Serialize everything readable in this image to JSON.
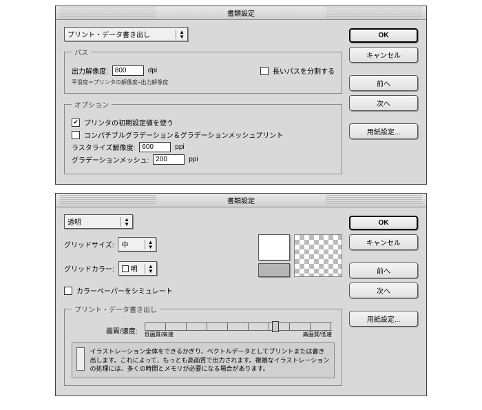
{
  "dialog1": {
    "title": "書類設定",
    "pageSelect": "プリント・データ書き出し",
    "path": {
      "legend": "パス",
      "resLabel": "出力解像度:",
      "resValue": "800",
      "resUnit": "dpi",
      "splitLabel": "長いパスを分割する",
      "note": "平滑度＝プリンタの解像度÷出力解像度"
    },
    "options": {
      "legend": "オプション",
      "useDefaults": "プリンタの初期設定値を使う",
      "compatGrad": "コンパチブルグラデーション＆グラデーションメッシュプリント",
      "rasterLabel": "ラスタライズ解像度:",
      "rasterValue": "600",
      "rasterUnit": "ppi",
      "meshLabel": "グラデーションメッシュ:",
      "meshValue": "200",
      "meshUnit": "ppi"
    },
    "buttons": {
      "ok": "OK",
      "cancel": "キャンセル",
      "prev": "前へ",
      "next": "次へ",
      "pageSetup": "用紙設定..."
    }
  },
  "dialog2": {
    "title": "書類設定",
    "pageSelect": "透明",
    "gridSizeLabel": "グリッドサイズ:",
    "gridSizeValue": "中",
    "gridColorLabel": "グリッドカラー:",
    "gridColorValue": "明",
    "simulatePaper": "カラーペーパーをシミュレート",
    "export": {
      "legend": "プリント・データ書き出し",
      "qualityLabel": "画質/速度:",
      "tickLow": "低画質/高速",
      "tickHigh": "高画質/低速",
      "infoText": "イラストレーション全体をできるかぎり、ベクトルデータとしてプリントまたは書き出します。これによって、もっとも高画質で出力されます。複雑なイラストレーションの処理には、多くの時間とメモリが必要になる場合があります。"
    },
    "buttons": {
      "ok": "OK",
      "cancel": "キャンセル",
      "prev": "前へ",
      "next": "次へ",
      "pageSetup": "用紙設定..."
    }
  }
}
